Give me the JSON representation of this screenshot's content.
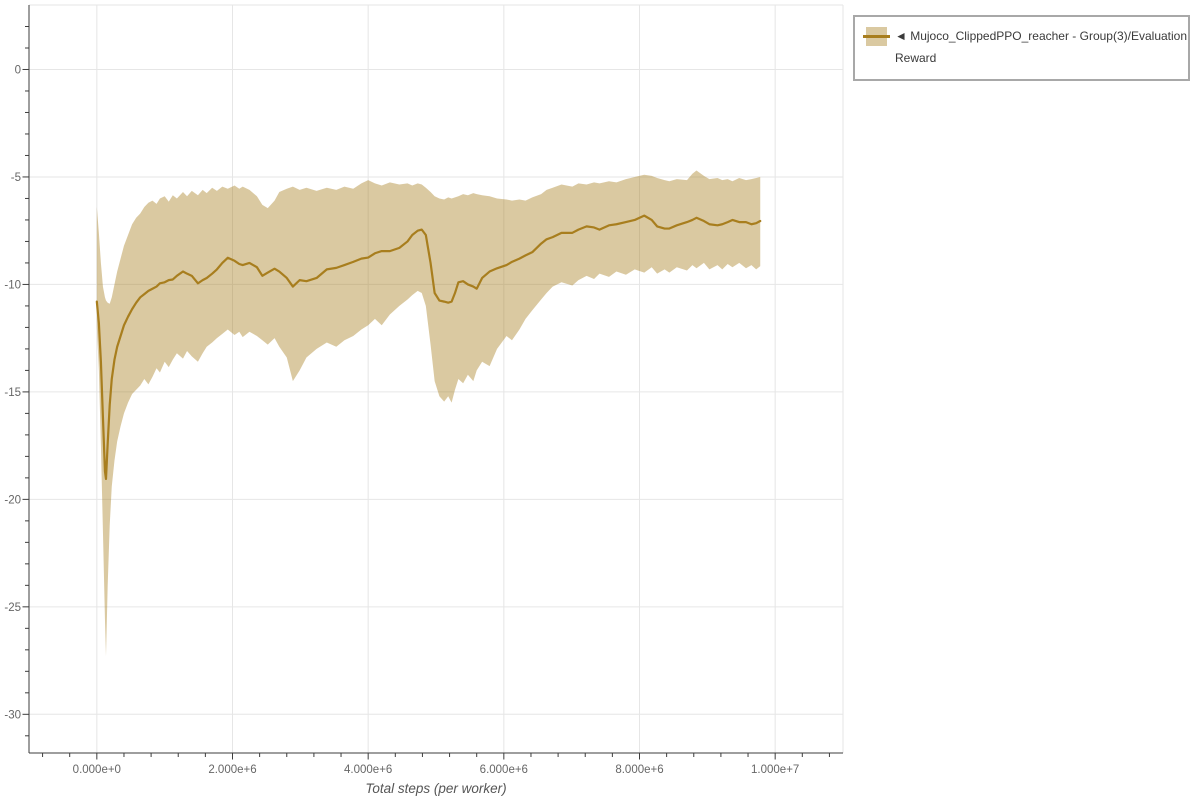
{
  "legend": {
    "entries": [
      {
        "label": "◄ Mujoco_ClippedPPO_reacher - Group(3)/Evaluation Reward",
        "label_lines": [
          "◄ Mujoco_ClippedPPO_reacher - Group(3)/Evaluation",
          "Reward"
        ],
        "color": "#a87e1e",
        "band_color": "rgba(168,126,30,0.42)"
      }
    ]
  },
  "colors": {
    "line": "#a87e1e",
    "band_base": "#a87e1e",
    "band_opacity": 0.42,
    "grid": "#e6e6e6",
    "axis": "#3c3c3c",
    "tick_label": "#666666",
    "axis_title": "#555555",
    "legend_border": "#a8a8a8"
  },
  "chart_data": {
    "type": "line",
    "title": "",
    "xlabel": "Total steps (per worker)",
    "ylabel": "",
    "grid": true,
    "legend_position": "top-right",
    "x_range": [
      -1000000,
      11000000
    ],
    "y_range": [
      -31.8,
      3.0
    ],
    "x_minor_step": 400000,
    "y_minor_step": 1,
    "x_ticks": [
      {
        "value": 0,
        "label": "0.000e+0"
      },
      {
        "value": 2000000,
        "label": "2.000e+6"
      },
      {
        "value": 4000000,
        "label": "4.000e+6"
      },
      {
        "value": 6000000,
        "label": "6.000e+6"
      },
      {
        "value": 8000000,
        "label": "8.000e+6"
      },
      {
        "value": 10000000,
        "label": "1.000e+7"
      }
    ],
    "y_ticks": [
      {
        "value": 0,
        "label": "0"
      },
      {
        "value": -5,
        "label": "-5"
      },
      {
        "value": -10,
        "label": "-10"
      },
      {
        "value": -15,
        "label": "-15"
      },
      {
        "value": -20,
        "label": "-20"
      },
      {
        "value": -25,
        "label": "-25"
      },
      {
        "value": -30,
        "label": "-30"
      }
    ],
    "series": [
      {
        "name": "Mujoco_ClippedPPO_reacher - Group(3)/Evaluation Reward",
        "color": "#a87e1e",
        "band_opacity": 0.42,
        "points_format": [
          "step",
          "mean",
          "lower",
          "upper"
        ],
        "points": [
          [
            0,
            -10.8,
            -12.0,
            -6.4
          ],
          [
            30000,
            -11.8,
            -14.0,
            -7.6
          ],
          [
            60000,
            -13.6,
            -17.5,
            -9.0
          ],
          [
            90000,
            -16.2,
            -21.5,
            -10.1
          ],
          [
            120000,
            -18.7,
            -25.6,
            -10.6
          ],
          [
            135000,
            -19.05,
            -27.3,
            -10.75
          ],
          [
            160000,
            -17.4,
            -24.0,
            -10.85
          ],
          [
            190000,
            -15.6,
            -21.2,
            -10.9
          ],
          [
            220000,
            -14.4,
            -19.4,
            -10.6
          ],
          [
            260000,
            -13.5,
            -18.2,
            -10.0
          ],
          [
            300000,
            -12.9,
            -17.3,
            -9.4
          ],
          [
            350000,
            -12.4,
            -16.6,
            -8.8
          ],
          [
            400000,
            -11.9,
            -16.0,
            -8.2
          ],
          [
            460000,
            -11.5,
            -15.5,
            -7.7
          ],
          [
            520000,
            -11.15,
            -15.1,
            -7.2
          ],
          [
            580000,
            -10.85,
            -14.9,
            -6.9
          ],
          [
            640000,
            -10.6,
            -14.7,
            -6.7
          ],
          [
            700000,
            -10.45,
            -14.4,
            -6.4
          ],
          [
            760000,
            -10.3,
            -14.65,
            -6.2
          ],
          [
            820000,
            -10.2,
            -14.3,
            -6.1
          ],
          [
            880000,
            -10.1,
            -13.9,
            -6.25
          ],
          [
            930000,
            -9.95,
            -14.1,
            -6.0
          ],
          [
            1000000,
            -9.9,
            -13.6,
            -5.9
          ],
          [
            1060000,
            -9.8,
            -13.85,
            -6.15
          ],
          [
            1120000,
            -9.77,
            -13.5,
            -5.85
          ],
          [
            1180000,
            -9.6,
            -13.2,
            -6.0
          ],
          [
            1270000,
            -9.4,
            -13.45,
            -5.7
          ],
          [
            1330000,
            -9.5,
            -13.1,
            -5.9
          ],
          [
            1400000,
            -9.6,
            -13.35,
            -5.65
          ],
          [
            1490000,
            -9.95,
            -13.6,
            -5.85
          ],
          [
            1560000,
            -9.8,
            -13.2,
            -5.6
          ],
          [
            1620000,
            -9.7,
            -12.9,
            -5.75
          ],
          [
            1700000,
            -9.5,
            -12.7,
            -5.5
          ],
          [
            1770000,
            -9.3,
            -12.5,
            -5.65
          ],
          [
            1850000,
            -9.0,
            -12.3,
            -5.45
          ],
          [
            1930000,
            -8.76,
            -12.1,
            -5.55
          ],
          [
            2030000,
            -8.9,
            -12.35,
            -5.4
          ],
          [
            2100000,
            -9.05,
            -12.2,
            -5.55
          ],
          [
            2150000,
            -9.1,
            -12.45,
            -5.45
          ],
          [
            2250000,
            -9.0,
            -12.2,
            -5.6
          ],
          [
            2360000,
            -9.2,
            -12.4,
            -5.9
          ],
          [
            2440000,
            -9.6,
            -12.6,
            -6.3
          ],
          [
            2520000,
            -9.45,
            -12.8,
            -6.45
          ],
          [
            2620000,
            -9.27,
            -12.5,
            -6.1
          ],
          [
            2690000,
            -9.4,
            -12.9,
            -5.7
          ],
          [
            2800000,
            -9.7,
            -13.4,
            -5.55
          ],
          [
            2890000,
            -10.1,
            -14.5,
            -5.45
          ],
          [
            2990000,
            -9.8,
            -14.0,
            -5.6
          ],
          [
            3090000,
            -9.85,
            -13.4,
            -5.5
          ],
          [
            3240000,
            -9.7,
            -13.0,
            -5.65
          ],
          [
            3390000,
            -9.3,
            -12.7,
            -5.5
          ],
          [
            3530000,
            -9.23,
            -12.9,
            -5.6
          ],
          [
            3650000,
            -9.1,
            -12.6,
            -5.45
          ],
          [
            3780000,
            -8.95,
            -12.4,
            -5.55
          ],
          [
            3900000,
            -8.8,
            -12.1,
            -5.3
          ],
          [
            4000000,
            -8.75,
            -11.9,
            -5.15
          ],
          [
            4100000,
            -8.55,
            -11.6,
            -5.3
          ],
          [
            4200000,
            -8.45,
            -11.9,
            -5.4
          ],
          [
            4320000,
            -8.45,
            -11.4,
            -5.25
          ],
          [
            4460000,
            -8.3,
            -11.0,
            -5.35
          ],
          [
            4580000,
            -8.0,
            -10.7,
            -5.3
          ],
          [
            4650000,
            -7.7,
            -10.5,
            -5.4
          ],
          [
            4730000,
            -7.5,
            -10.3,
            -5.3
          ],
          [
            4790000,
            -7.45,
            -10.4,
            -5.35
          ],
          [
            4850000,
            -7.7,
            -11.0,
            -5.5
          ],
          [
            4920000,
            -9.0,
            -12.8,
            -5.7
          ],
          [
            4980000,
            -10.4,
            -14.5,
            -5.9
          ],
          [
            5050000,
            -10.75,
            -15.2,
            -6.0
          ],
          [
            5120000,
            -10.8,
            -15.45,
            -6.05
          ],
          [
            5180000,
            -10.85,
            -15.2,
            -5.95
          ],
          [
            5230000,
            -10.8,
            -15.5,
            -6.0
          ],
          [
            5280000,
            -10.4,
            -14.9,
            -5.95
          ],
          [
            5330000,
            -9.9,
            -14.4,
            -5.9
          ],
          [
            5400000,
            -9.85,
            -14.6,
            -5.8
          ],
          [
            5470000,
            -10.0,
            -14.2,
            -5.85
          ],
          [
            5550000,
            -10.1,
            -14.5,
            -5.75
          ],
          [
            5600000,
            -10.2,
            -14.0,
            -5.8
          ],
          [
            5680000,
            -9.7,
            -13.6,
            -5.85
          ],
          [
            5790000,
            -9.4,
            -13.8,
            -5.9
          ],
          [
            5900000,
            -9.25,
            -13.0,
            -6.0
          ],
          [
            6040000,
            -9.1,
            -12.4,
            -6.05
          ],
          [
            6120000,
            -8.95,
            -12.6,
            -6.1
          ],
          [
            6230000,
            -8.8,
            -12.1,
            -6.05
          ],
          [
            6320000,
            -8.65,
            -11.6,
            -6.1
          ],
          [
            6420000,
            -8.5,
            -11.2,
            -5.95
          ],
          [
            6550000,
            -8.1,
            -10.7,
            -5.8
          ],
          [
            6630000,
            -7.9,
            -10.4,
            -5.6
          ],
          [
            6720000,
            -7.8,
            -10.1,
            -5.5
          ],
          [
            6850000,
            -7.6,
            -9.9,
            -5.35
          ],
          [
            7010000,
            -7.6,
            -10.05,
            -5.45
          ],
          [
            7100000,
            -7.45,
            -9.8,
            -5.3
          ],
          [
            7220000,
            -7.3,
            -9.6,
            -5.35
          ],
          [
            7330000,
            -7.35,
            -9.75,
            -5.25
          ],
          [
            7410000,
            -7.45,
            -9.5,
            -5.3
          ],
          [
            7550000,
            -7.25,
            -9.65,
            -5.2
          ],
          [
            7660000,
            -7.2,
            -9.4,
            -5.25
          ],
          [
            7800000,
            -7.1,
            -9.55,
            -5.1
          ],
          [
            7930000,
            -7.0,
            -9.3,
            -5.0
          ],
          [
            8070000,
            -6.8,
            -9.45,
            -4.9
          ],
          [
            8180000,
            -7.0,
            -9.2,
            -4.95
          ],
          [
            8260000,
            -7.3,
            -9.5,
            -5.05
          ],
          [
            8370000,
            -7.4,
            -9.3,
            -5.15
          ],
          [
            8440000,
            -7.4,
            -9.45,
            -5.2
          ],
          [
            8550000,
            -7.25,
            -9.2,
            -5.1
          ],
          [
            8700000,
            -7.1,
            -9.35,
            -5.15
          ],
          [
            8780000,
            -7.0,
            -9.1,
            -4.85
          ],
          [
            8840000,
            -6.9,
            -9.25,
            -4.7
          ],
          [
            8950000,
            -7.05,
            -9.0,
            -4.95
          ],
          [
            9030000,
            -7.2,
            -9.3,
            -5.1
          ],
          [
            9150000,
            -7.25,
            -9.1,
            -5.05
          ],
          [
            9220000,
            -7.2,
            -9.3,
            -5.15
          ],
          [
            9300000,
            -7.1,
            -9.05,
            -5.1
          ],
          [
            9370000,
            -7.0,
            -9.2,
            -5.2
          ],
          [
            9470000,
            -7.1,
            -9.0,
            -5.05
          ],
          [
            9570000,
            -7.1,
            -9.25,
            -5.15
          ],
          [
            9650000,
            -7.2,
            -9.1,
            -5.1
          ],
          [
            9720000,
            -7.15,
            -9.3,
            -5.05
          ],
          [
            9780000,
            -7.05,
            -9.15,
            -5.0
          ]
        ]
      }
    ]
  }
}
